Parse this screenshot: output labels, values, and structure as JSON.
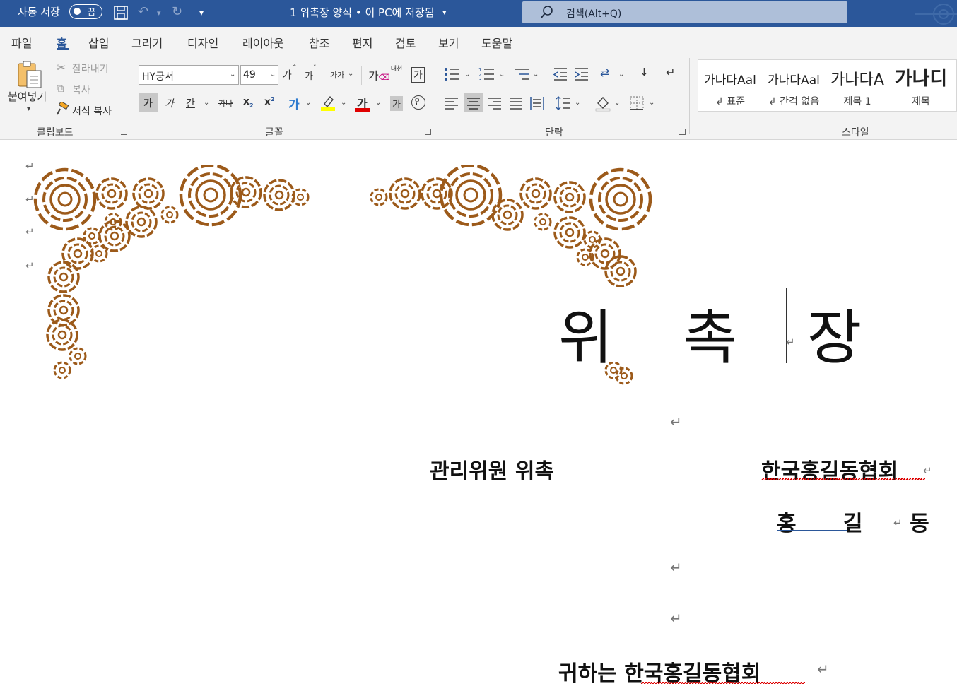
{
  "titlebar": {
    "autosave_label": "자동 저장",
    "autosave_state": "끔",
    "doc_title": "1 위촉장 양식 • 이 PC에 저장됨",
    "search_placeholder": "검색(Alt+Q)",
    "icons": [
      "save-icon",
      "undo-icon",
      "redo-icon",
      "customize-qat-icon",
      "search-icon"
    ]
  },
  "tabs": [
    {
      "label": "파일"
    },
    {
      "label": "홈",
      "active": true
    },
    {
      "label": "삽입"
    },
    {
      "label": "그리기"
    },
    {
      "label": "디자인"
    },
    {
      "label": "레이아웃"
    },
    {
      "label": "참조"
    },
    {
      "label": "편지"
    },
    {
      "label": "검토"
    },
    {
      "label": "보기"
    },
    {
      "label": "도움말"
    }
  ],
  "ribbon": {
    "clipboard": {
      "group_label": "클립보드",
      "paste_label": "붙여넣기",
      "cut_label": "잘라내기",
      "copy_label": "복사",
      "format_painter_label": "서식 복사"
    },
    "font": {
      "group_label": "글꼴",
      "font_name": "HY궁서",
      "font_size": "49",
      "grow_label": "가",
      "shrink_label": "가",
      "case_label": "가가",
      "phonetic_label": "내천",
      "enclose_label": "가",
      "bold_label": "가",
      "italic_label": "가",
      "underline_label": "간",
      "strike_label": "가나",
      "subscript_label": "x",
      "superscript_label": "x",
      "effects_label": "가",
      "color_label": "가",
      "shading_label": "가",
      "circle_label": "인",
      "highlight_color": "#ffff00",
      "font_color": "#e00000"
    },
    "paragraph": {
      "group_label": "단락"
    },
    "styles": {
      "group_label": "스타일",
      "items": [
        {
          "preview": "가나다Aal",
          "name": "↲ 표준"
        },
        {
          "preview": "가나다Aal",
          "name": "↲ 간격 없음"
        },
        {
          "preview": "가나다A",
          "name": "제목 1"
        },
        {
          "preview": "가나디",
          "name": "제목"
        }
      ]
    }
  },
  "document": {
    "title": "위 촉 장",
    "position_text": "관리위원 위촉",
    "org_name": "한국홍길동협회",
    "person_name": "홍 길 동",
    "closing_text": "귀하는 한국홍길동협회",
    "paragraph_mark": "↵",
    "ornament_color": "#9c5a1a"
  }
}
